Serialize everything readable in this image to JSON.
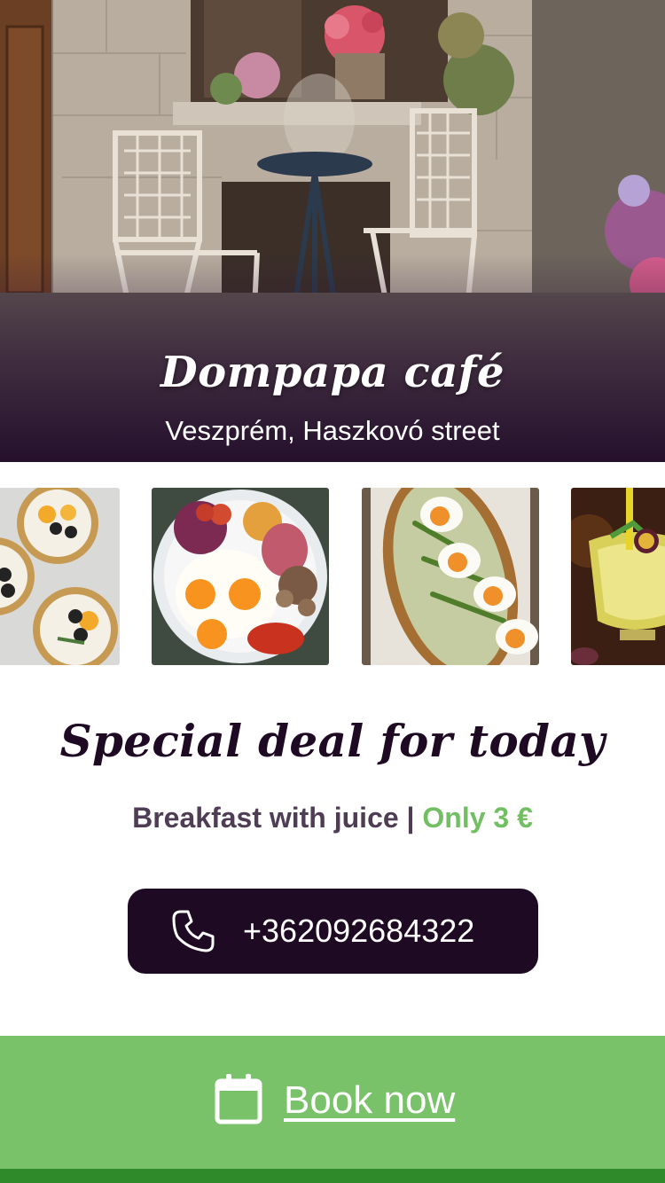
{
  "hero": {
    "title": "Dompapa café",
    "subtitle": "Veszprém, Haszkovó street"
  },
  "gallery": {
    "items": [
      {
        "name": "fruit-tarts-photo"
      },
      {
        "name": "fried-eggs-breakfast-photo"
      },
      {
        "name": "egg-asparagus-toast-photo"
      },
      {
        "name": "passion-fruit-drink-photo"
      }
    ]
  },
  "deal": {
    "title": "Special deal for today",
    "description": "Breakfast with juice",
    "separator": " | ",
    "price": "Only 3 €"
  },
  "phone": {
    "number": "+362092684322",
    "icon": "phone-icon"
  },
  "booking": {
    "label": "Book now",
    "icon": "calendar-icon"
  },
  "colors": {
    "brand_dark": "#1f0a24",
    "accent_green": "#72bf63",
    "book_bar": "#7ac26a",
    "bottom_strip": "#2f8a2a"
  }
}
